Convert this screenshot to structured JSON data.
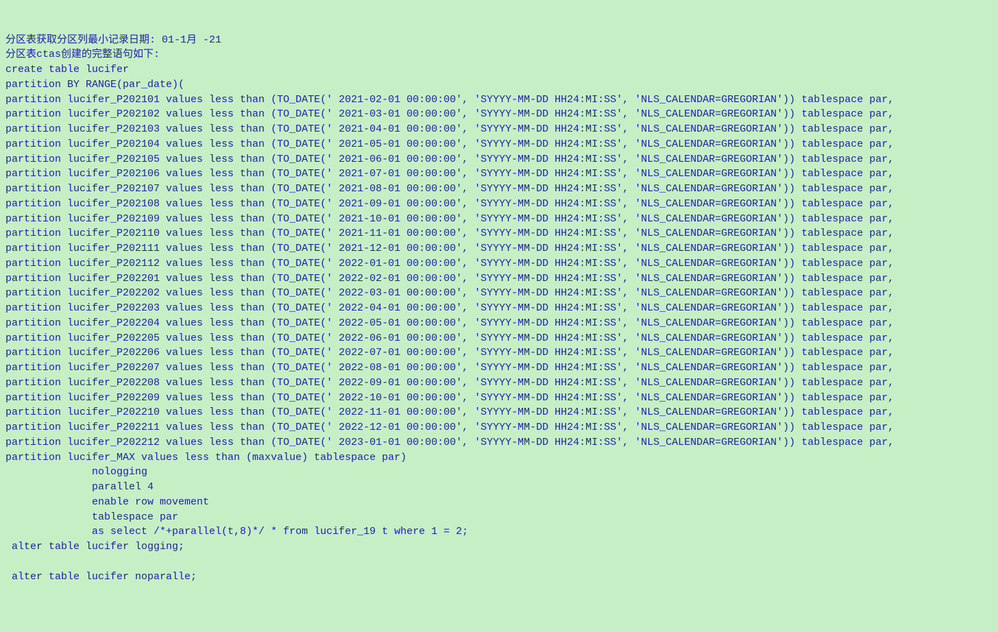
{
  "header": {
    "line1": "分区表获取分区列最小记录日期: 01-1月 -21",
    "line2": "分区表ctas创建的完整语句如下:",
    "line3": "create table lucifer",
    "line4": "partition BY RANGE(par_date)("
  },
  "partitions": [
    "partition lucifer_P202101 values less than (TO_DATE(' 2021-02-01 00:00:00', 'SYYYY-MM-DD HH24:MI:SS', 'NLS_CALENDAR=GREGORIAN')) tablespace par,",
    "partition lucifer_P202102 values less than (TO_DATE(' 2021-03-01 00:00:00', 'SYYYY-MM-DD HH24:MI:SS', 'NLS_CALENDAR=GREGORIAN')) tablespace par,",
    "partition lucifer_P202103 values less than (TO_DATE(' 2021-04-01 00:00:00', 'SYYYY-MM-DD HH24:MI:SS', 'NLS_CALENDAR=GREGORIAN')) tablespace par,",
    "partition lucifer_P202104 values less than (TO_DATE(' 2021-05-01 00:00:00', 'SYYYY-MM-DD HH24:MI:SS', 'NLS_CALENDAR=GREGORIAN')) tablespace par,",
    "partition lucifer_P202105 values less than (TO_DATE(' 2021-06-01 00:00:00', 'SYYYY-MM-DD HH24:MI:SS', 'NLS_CALENDAR=GREGORIAN')) tablespace par,",
    "partition lucifer_P202106 values less than (TO_DATE(' 2021-07-01 00:00:00', 'SYYYY-MM-DD HH24:MI:SS', 'NLS_CALENDAR=GREGORIAN')) tablespace par,",
    "partition lucifer_P202107 values less than (TO_DATE(' 2021-08-01 00:00:00', 'SYYYY-MM-DD HH24:MI:SS', 'NLS_CALENDAR=GREGORIAN')) tablespace par,",
    "partition lucifer_P202108 values less than (TO_DATE(' 2021-09-01 00:00:00', 'SYYYY-MM-DD HH24:MI:SS', 'NLS_CALENDAR=GREGORIAN')) tablespace par,",
    "partition lucifer_P202109 values less than (TO_DATE(' 2021-10-01 00:00:00', 'SYYYY-MM-DD HH24:MI:SS', 'NLS_CALENDAR=GREGORIAN')) tablespace par,",
    "partition lucifer_P202110 values less than (TO_DATE(' 2021-11-01 00:00:00', 'SYYYY-MM-DD HH24:MI:SS', 'NLS_CALENDAR=GREGORIAN')) tablespace par,",
    "partition lucifer_P202111 values less than (TO_DATE(' 2021-12-01 00:00:00', 'SYYYY-MM-DD HH24:MI:SS', 'NLS_CALENDAR=GREGORIAN')) tablespace par,",
    "partition lucifer_P202112 values less than (TO_DATE(' 2022-01-01 00:00:00', 'SYYYY-MM-DD HH24:MI:SS', 'NLS_CALENDAR=GREGORIAN')) tablespace par,",
    "partition lucifer_P202201 values less than (TO_DATE(' 2022-02-01 00:00:00', 'SYYYY-MM-DD HH24:MI:SS', 'NLS_CALENDAR=GREGORIAN')) tablespace par,",
    "partition lucifer_P202202 values less than (TO_DATE(' 2022-03-01 00:00:00', 'SYYYY-MM-DD HH24:MI:SS', 'NLS_CALENDAR=GREGORIAN')) tablespace par,",
    "partition lucifer_P202203 values less than (TO_DATE(' 2022-04-01 00:00:00', 'SYYYY-MM-DD HH24:MI:SS', 'NLS_CALENDAR=GREGORIAN')) tablespace par,",
    "partition lucifer_P202204 values less than (TO_DATE(' 2022-05-01 00:00:00', 'SYYYY-MM-DD HH24:MI:SS', 'NLS_CALENDAR=GREGORIAN')) tablespace par,",
    "partition lucifer_P202205 values less than (TO_DATE(' 2022-06-01 00:00:00', 'SYYYY-MM-DD HH24:MI:SS', 'NLS_CALENDAR=GREGORIAN')) tablespace par,",
    "partition lucifer_P202206 values less than (TO_DATE(' 2022-07-01 00:00:00', 'SYYYY-MM-DD HH24:MI:SS', 'NLS_CALENDAR=GREGORIAN')) tablespace par,",
    "partition lucifer_P202207 values less than (TO_DATE(' 2022-08-01 00:00:00', 'SYYYY-MM-DD HH24:MI:SS', 'NLS_CALENDAR=GREGORIAN')) tablespace par,",
    "partition lucifer_P202208 values less than (TO_DATE(' 2022-09-01 00:00:00', 'SYYYY-MM-DD HH24:MI:SS', 'NLS_CALENDAR=GREGORIAN')) tablespace par,",
    "partition lucifer_P202209 values less than (TO_DATE(' 2022-10-01 00:00:00', 'SYYYY-MM-DD HH24:MI:SS', 'NLS_CALENDAR=GREGORIAN')) tablespace par,",
    "partition lucifer_P202210 values less than (TO_DATE(' 2022-11-01 00:00:00', 'SYYYY-MM-DD HH24:MI:SS', 'NLS_CALENDAR=GREGORIAN')) tablespace par,",
    "partition lucifer_P202211 values less than (TO_DATE(' 2022-12-01 00:00:00', 'SYYYY-MM-DD HH24:MI:SS', 'NLS_CALENDAR=GREGORIAN')) tablespace par,",
    "partition lucifer_P202212 values less than (TO_DATE(' 2023-01-01 00:00:00', 'SYYYY-MM-DD HH24:MI:SS', 'NLS_CALENDAR=GREGORIAN')) tablespace par,"
  ],
  "tail": {
    "max": "partition lucifer_MAX values less than (maxvalue) tablespace par)",
    "nologging": "              nologging",
    "parallel": "              parallel 4",
    "enable": "              enable row movement",
    "tablespace": "              tablespace par",
    "asselect": "              as select /*+parallel(t,8)*/ * from lucifer_19 t where 1 = 2;",
    "alter1": " alter table lucifer logging;",
    "blank": "",
    "alter2": " alter table lucifer noparalle;"
  }
}
